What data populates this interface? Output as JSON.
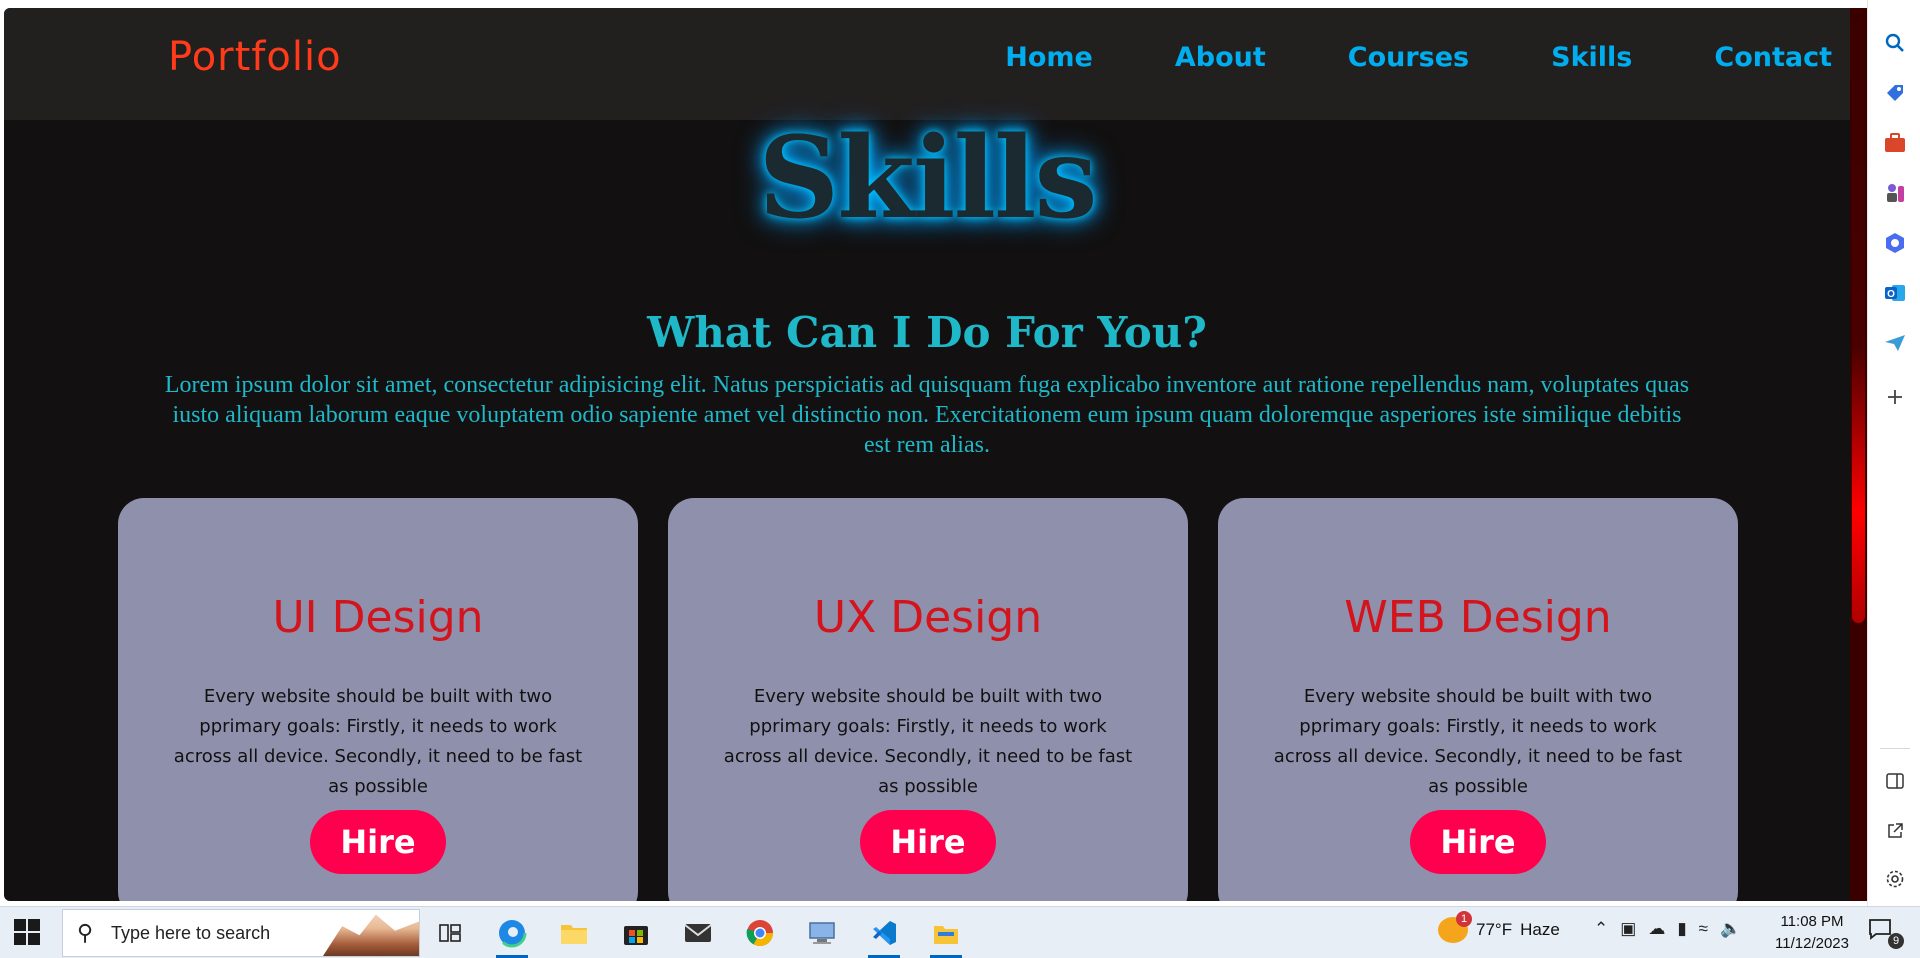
{
  "header": {
    "logo": "Portfolio",
    "nav": [
      "Home",
      "About",
      "Courses",
      "Skills",
      "Contact"
    ]
  },
  "section": {
    "title": "Skills",
    "subtitle": "What Can I Do For You?",
    "intro": "Lorem ipsum dolor sit amet, consectetur adipisicing elit. Natus perspiciatis ad quisquam fuga explicabo inventore aut ratione repellendus nam, voluptates quas iusto aliquam laborum eaque voluptatem odio sapiente amet vel distinctio non. Exercitationem eum ipsum quam doloremque asperiores iste similique debitis est rem alias."
  },
  "cards": [
    {
      "title": "UI Design",
      "text": "Every website should be built with two pprimary goals: Firstly, it needs to work across all device. Secondly, it need to be fast as possible",
      "button": "Hire"
    },
    {
      "title": "UX Design",
      "text": "Every website should be built with two pprimary goals: Firstly, it needs to work across all device. Secondly, it need to be fast as possible",
      "button": "Hire"
    },
    {
      "title": "WEB Design",
      "text": "Every website should be built with two pprimary goals: Firstly, it needs to work across all device. Secondly, it need to be fast as possible",
      "button": "Hire"
    }
  ],
  "taskbar": {
    "search_placeholder": "Type here to search",
    "weather": {
      "temp": "77°F",
      "condition": "Haze",
      "badge": "1"
    },
    "clock": {
      "time": "11:08 PM",
      "date": "11/12/2023"
    },
    "notification_count": "9",
    "apps": [
      "task-view-icon",
      "edge-icon",
      "file-explorer-icon",
      "store-icon",
      "mail-icon",
      "chrome-icon",
      "computer-icon",
      "vscode-icon",
      "folder-icon"
    ]
  },
  "sidebar_icons": [
    "search-icon",
    "tag-icon",
    "briefcase-icon",
    "chess-icon",
    "office-icon",
    "outlook-icon",
    "send-icon",
    "add-icon",
    "panel-icon",
    "external-icon",
    "settings-icon"
  ],
  "colors": {
    "page_bg": "#121010",
    "header_bg": "#221f1f",
    "logo": "#ff3b1a",
    "nav": "#00aeef",
    "accent_text": "#1fb8c8",
    "card_bg": "#8f91ac",
    "card_title": "#d3141c",
    "hire_button": "#ff004f"
  }
}
